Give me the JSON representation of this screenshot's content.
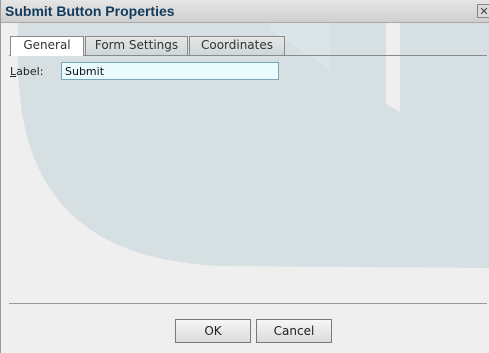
{
  "dialog": {
    "title": "Submit Button Properties",
    "close_icon": "close-icon"
  },
  "tabs": [
    {
      "label": "General",
      "active": true
    },
    {
      "label": "Form Settings",
      "active": false
    },
    {
      "label": "Coordinates",
      "active": false
    }
  ],
  "general": {
    "label_mnemonic": "L",
    "label_rest": "abel:",
    "label_value": "Submit"
  },
  "buttons": {
    "ok": "OK",
    "cancel": "Cancel"
  },
  "colors": {
    "title_text": "#123a5c",
    "background_shape": "#b7d3dc"
  }
}
